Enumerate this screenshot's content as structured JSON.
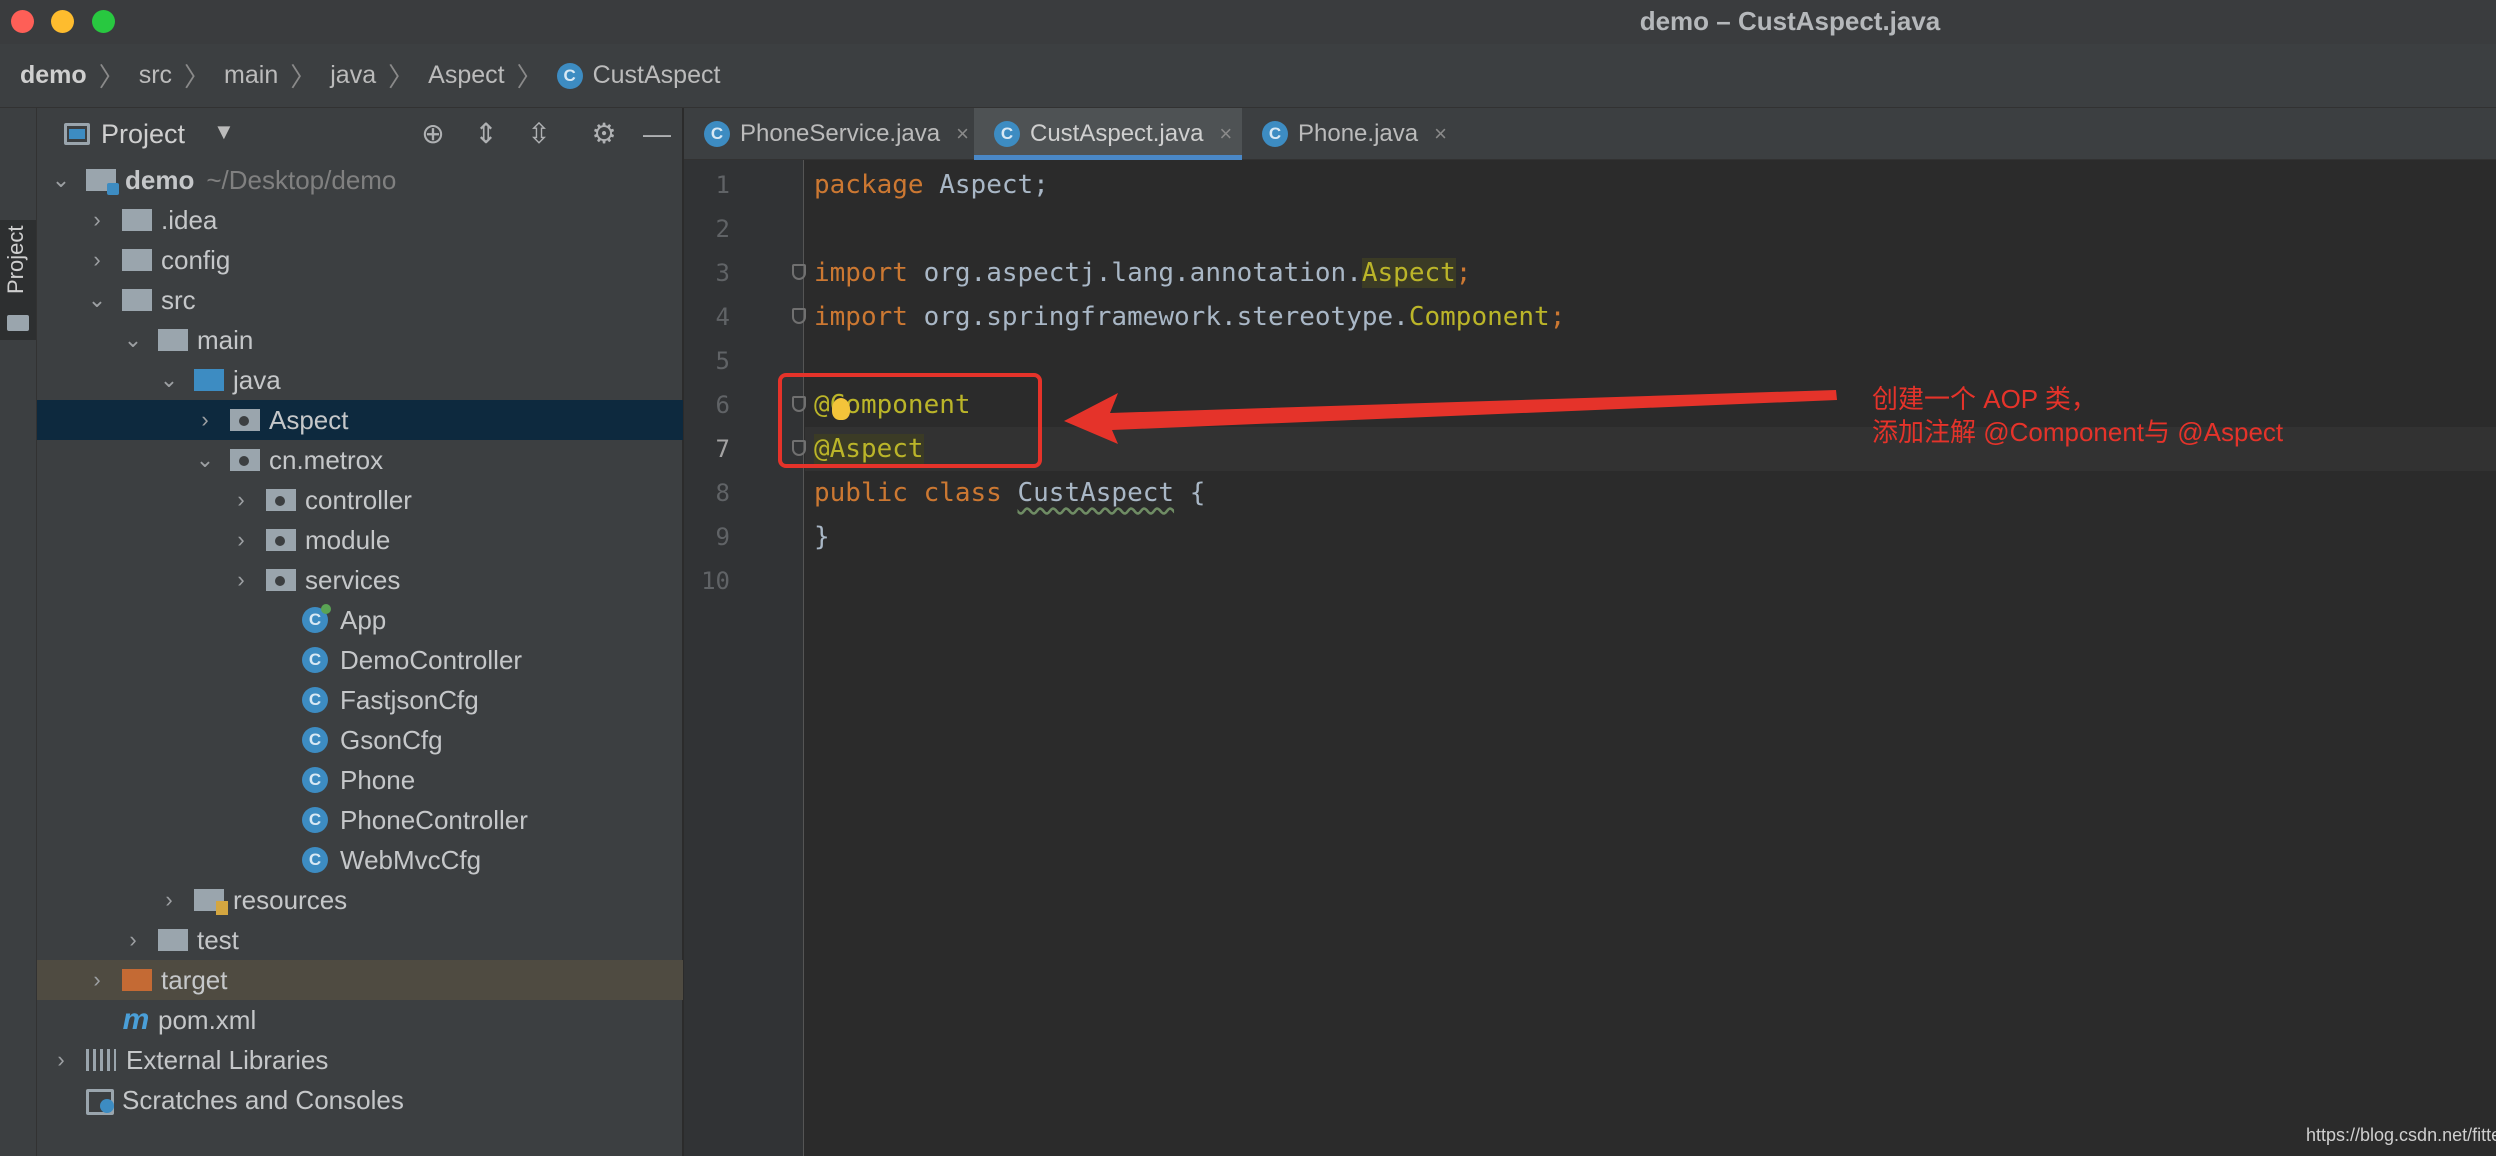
{
  "window": {
    "title": "demo – CustAspect.java"
  },
  "breadcrumb": [
    "demo",
    "src",
    "main",
    "java",
    "Aspect",
    "CustAspect"
  ],
  "side_strip": {
    "label": "Project"
  },
  "project_panel": {
    "title": "Project",
    "root": {
      "name": "demo",
      "path": "~/Desktop/demo"
    },
    "items": [
      {
        "label": ".idea"
      },
      {
        "label": "config"
      },
      {
        "label": "src"
      },
      {
        "label": "main"
      },
      {
        "label": "java"
      },
      {
        "label": "Aspect"
      },
      {
        "label": "cn.metrox"
      },
      {
        "label": "controller"
      },
      {
        "label": "module"
      },
      {
        "label": "services"
      },
      {
        "label": "App"
      },
      {
        "label": "DemoController"
      },
      {
        "label": "FastjsonCfg"
      },
      {
        "label": "GsonCfg"
      },
      {
        "label": "Phone"
      },
      {
        "label": "PhoneController"
      },
      {
        "label": "WebMvcCfg"
      },
      {
        "label": "resources"
      },
      {
        "label": "test"
      },
      {
        "label": "target"
      },
      {
        "label": "pom.xml"
      },
      {
        "label": "External Libraries"
      },
      {
        "label": "Scratches and Consoles"
      }
    ]
  },
  "tabs": [
    {
      "label": "PhoneService.java",
      "close": "×"
    },
    {
      "label": "CustAspect.java",
      "close": "×"
    },
    {
      "label": "Phone.java",
      "close": "×"
    }
  ],
  "editor": {
    "line_numbers": [
      "1",
      "2",
      "3",
      "4",
      "5",
      "6",
      "7",
      "8",
      "9",
      "10"
    ],
    "code": {
      "l1_kw": "package",
      "l1_rest": " Aspect;",
      "l3_kw": "import",
      "l3_pkg": " org.aspectj.lang.annotation.",
      "l3_cls": "Aspect",
      "l3_end": ";",
      "l4_kw": "import",
      "l4_pkg": " org.springframework.stereotype.",
      "l4_cls": "Component",
      "l4_end": ";",
      "l6_ann": "@Component",
      "l7_ann": "@Aspect",
      "l8_kw": "public class",
      "l8_cls": "CustAspect",
      "l8_end": " {",
      "l9": "}"
    }
  },
  "annotation": {
    "line1": "创建一个 AOP 类，",
    "line2": "添加注解 @Component与 @Aspect",
    "color": "#e5332a"
  },
  "watermark": "https://blog.csdn.net/fittec",
  "colors": {
    "keyword": "#cc7832",
    "annotation": "#bbb529",
    "accent": "#4a88c7",
    "selection": "#0d293e"
  }
}
